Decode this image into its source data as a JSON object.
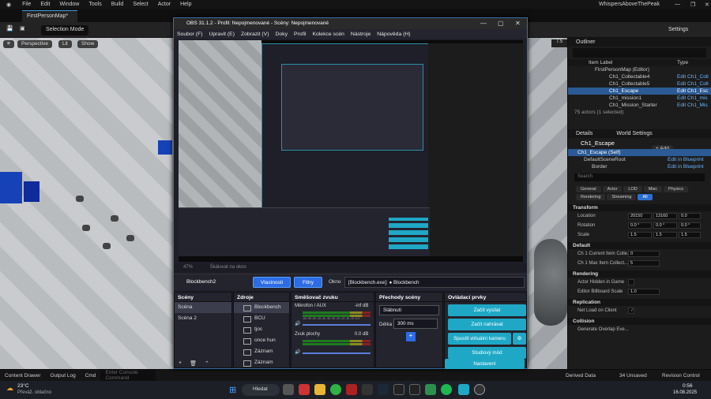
{
  "ue": {
    "menu": [
      "File",
      "Edit",
      "Window",
      "Tools",
      "Build",
      "Select",
      "Actor",
      "Help"
    ],
    "project": "WhispersAboveThePeak",
    "map_tab": "FirstPersonMap*",
    "selection_mode": "Selection Mode",
    "settings": "Settings",
    "viewport_buttons": [
      "Perspective",
      "Lit",
      "Show"
    ],
    "fps": "7.5",
    "outliner": {
      "tab": "Outliner",
      "col_label": "Item Label",
      "col_type": "Type",
      "root": "FirstPersonMap (Editor)",
      "rows": [
        {
          "label": "Ch1_Collectable4",
          "type": "Edit Ch1_Coll"
        },
        {
          "label": "Ch1_Collectable5",
          "type": "Edit Ch1_Coll"
        },
        {
          "label": "Ch1_Escape",
          "type": "Edit Ch1_Esc"
        },
        {
          "label": "Ch1_mission1",
          "type": "Edit Ch1_mis"
        },
        {
          "label": "Ch1_Mission_Starter",
          "type": "Edit Ch1_Mis"
        }
      ],
      "count": "75 actors (1 selected)"
    },
    "details": {
      "tab": "Details",
      "tab2": "World Settings",
      "actor": "Ch1_Escape",
      "add": "+ Add",
      "self": "Ch1_Escape (Self)",
      "comp1": "DefaultSceneRoot",
      "comp1_link": "Edit in Blueprint",
      "comp2": "Border",
      "comp2_link": "Edit in Blueprint",
      "search_placeholder": "Search",
      "filters": [
        "General",
        "Actor",
        "LOD",
        "Misc",
        "Physics",
        "Rendering",
        "Streaming",
        "All"
      ],
      "transform": "Transform",
      "location": "Location",
      "loc_vals": [
        "20150",
        "13160",
        "0.0"
      ],
      "rotation": "Rotation",
      "rot_vals": [
        "0.0 °",
        "0.0 °",
        "0.0 °"
      ],
      "scale": "Scale",
      "scale_vals": [
        "1.5",
        "1.5",
        "1.5"
      ],
      "default": "Default",
      "ch1_current": "Ch 1 Current Item Colle...",
      "ch1_current_val": "0",
      "ch1_max": "Ch 1 Max Item Collect...",
      "ch1_max_val": "5",
      "rendering": "Rendering",
      "hidden": "Actor Hidden in Game",
      "billboard": "Editor Billboard Scale",
      "billboard_val": "1.0",
      "replication": "Replication",
      "net_load": "Net Load on Client",
      "collision": "Collision",
      "overlap": "Generate Overlap Eve..."
    },
    "bottom": {
      "content_drawer": "Content Drawer",
      "output_log": "Output Log",
      "cmd": "Cmd",
      "console_placeholder": "Enter Console Command",
      "derived": "Derived Data",
      "unsaved": "34 Unsaved",
      "revision": "Revision Control"
    }
  },
  "obs": {
    "title": "OBS 31.1.2 - Profil: Nepojmenované - Scény: Nepojmenované",
    "menu": [
      "Soubor (F)",
      "Upravit (E)",
      "Zobrazit (V)",
      "Doky",
      "Profil",
      "Kolekce scén",
      "Nástroje",
      "Nápověda (H)"
    ],
    "zoom": "47%",
    "scale_label": "Škálovat na okno",
    "source_name": "Blockbench2",
    "btn_props": "Vlastnosti",
    "btn_filters": "Filtry",
    "window_label": "Okno",
    "window_value": "[Blockbench.exe]: ● Blockbench",
    "scenes": {
      "title": "Scény",
      "items": [
        "Scéna",
        "Scéna 2"
      ]
    },
    "sources": {
      "title": "Zdroje",
      "items": [
        "Blockbench",
        "BCU",
        "tjoc",
        "once hun",
        "Záznam",
        "Záznam"
      ]
    },
    "mixer": {
      "title": "Směšovač zvuku",
      "ch1": "Mikrofon / AUX",
      "ch1_db": "-inf dB",
      "ch2": "Zvuk plochy",
      "ch2_db": "0.0 dB",
      "ticks": "-60 -55 -50 -45 -40 -35 -30 -25 -20 -15 -10 -5 0"
    },
    "transitions": {
      "title": "Přechody scény",
      "type": "Slábnutí",
      "dur_label": "Délka",
      "dur": "300 ms"
    },
    "controls": {
      "title": "Ovládací prvky",
      "buttons": [
        "Začít vysílat",
        "Začít nahrávat",
        "Spustit virtuální kameru",
        "Studiový mód",
        "Nastavení"
      ]
    }
  },
  "taskbar": {
    "weather_temp": "23°C",
    "weather_text": "Převáž. oblačno",
    "search": "Hledat",
    "time": "0:56",
    "date": "16.08.2025"
  }
}
